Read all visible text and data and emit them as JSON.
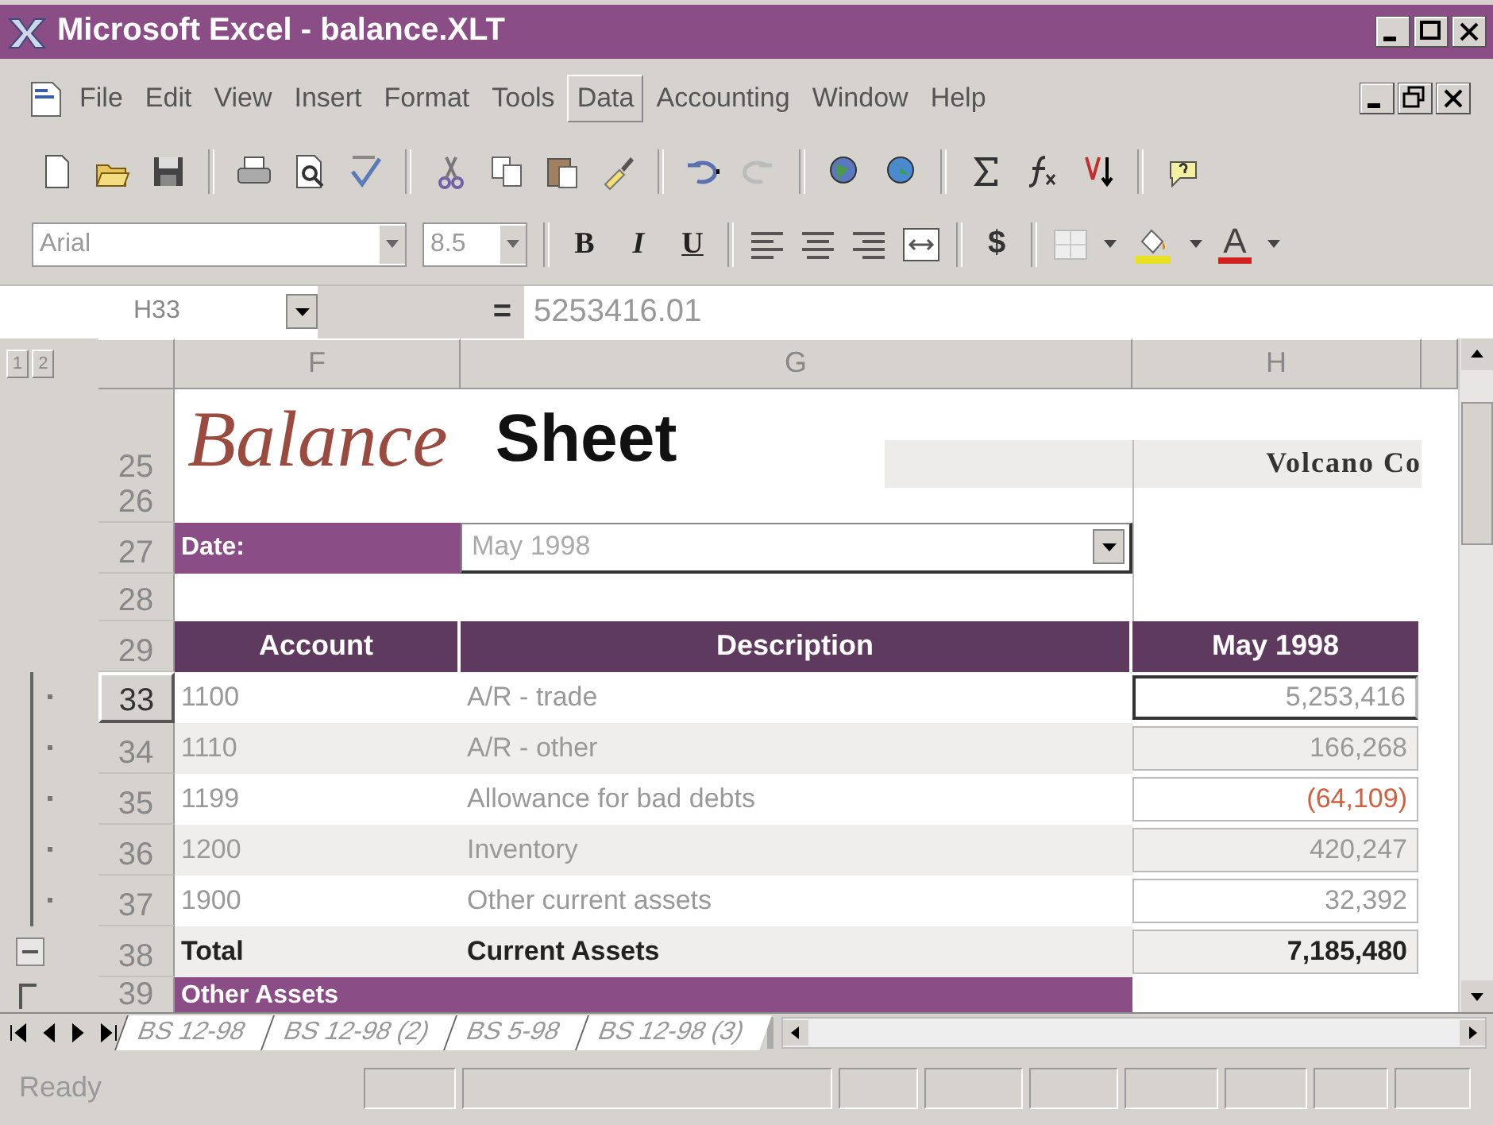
{
  "window": {
    "title": "Microsoft Excel - balance.XLT"
  },
  "menu": [
    {
      "label": "File",
      "selected": false
    },
    {
      "label": "Edit",
      "selected": false
    },
    {
      "label": "View",
      "selected": false
    },
    {
      "label": "Insert",
      "selected": false
    },
    {
      "label": "Format",
      "selected": false
    },
    {
      "label": "Tools",
      "selected": false
    },
    {
      "label": "Data",
      "selected": true
    },
    {
      "label": "Accounting",
      "selected": false
    },
    {
      "label": "Window",
      "selected": false
    },
    {
      "label": "Help",
      "selected": false
    }
  ],
  "formatting": {
    "font": "Arial",
    "size": "8.5",
    "style_buttons": [
      "B",
      "I",
      "U"
    ],
    "currency_button": "$",
    "font_color_button": "A"
  },
  "formula_bar": {
    "name_box": "H33",
    "equals": "=",
    "value": "5253416.01"
  },
  "outline_levels": [
    "1",
    "2"
  ],
  "columns": [
    "F",
    "G",
    "H"
  ],
  "sheet": [
    {
      "kind": "title",
      "row": "25",
      "title_italic": "Balance",
      "title_bold": "Sheet",
      "company": "Volcano Co"
    },
    {
      "kind": "blank",
      "row": "26"
    },
    {
      "kind": "date",
      "row": "27",
      "label": "Date:",
      "value": "May 1998"
    },
    {
      "kind": "blank",
      "row": "28"
    },
    {
      "kind": "header",
      "row": "29",
      "account": "Account",
      "description": "Description",
      "amount": "May 1998"
    },
    {
      "kind": "data",
      "row": "33",
      "account": "1100",
      "description": "A/R - trade",
      "amount": "5,253,416",
      "negative": false,
      "selected": true
    },
    {
      "kind": "data",
      "row": "34",
      "account": "1110",
      "description": "A/R - other",
      "amount": "166,268",
      "negative": false,
      "selected": false
    },
    {
      "kind": "data",
      "row": "35",
      "account": "1199",
      "description": "Allowance for bad debts",
      "amount": "(64,109)",
      "negative": true,
      "selected": false
    },
    {
      "kind": "data",
      "row": "36",
      "account": "1200",
      "description": "Inventory",
      "amount": "420,247",
      "negative": false,
      "selected": false
    },
    {
      "kind": "data",
      "row": "37",
      "account": "1900",
      "description": "Other current assets",
      "amount": "32,392",
      "negative": false,
      "selected": false
    },
    {
      "kind": "total",
      "row": "38",
      "account": "Total",
      "description": "Current Assets",
      "amount": "7,185,480"
    },
    {
      "kind": "section",
      "row": "39",
      "label": "Other Assets"
    }
  ],
  "sheet_tabs": [
    "BS 12-98",
    "BS 12-98 (2)",
    "BS 5-98",
    "BS 12-98 (3)"
  ],
  "status_bar": {
    "text": "Ready"
  }
}
